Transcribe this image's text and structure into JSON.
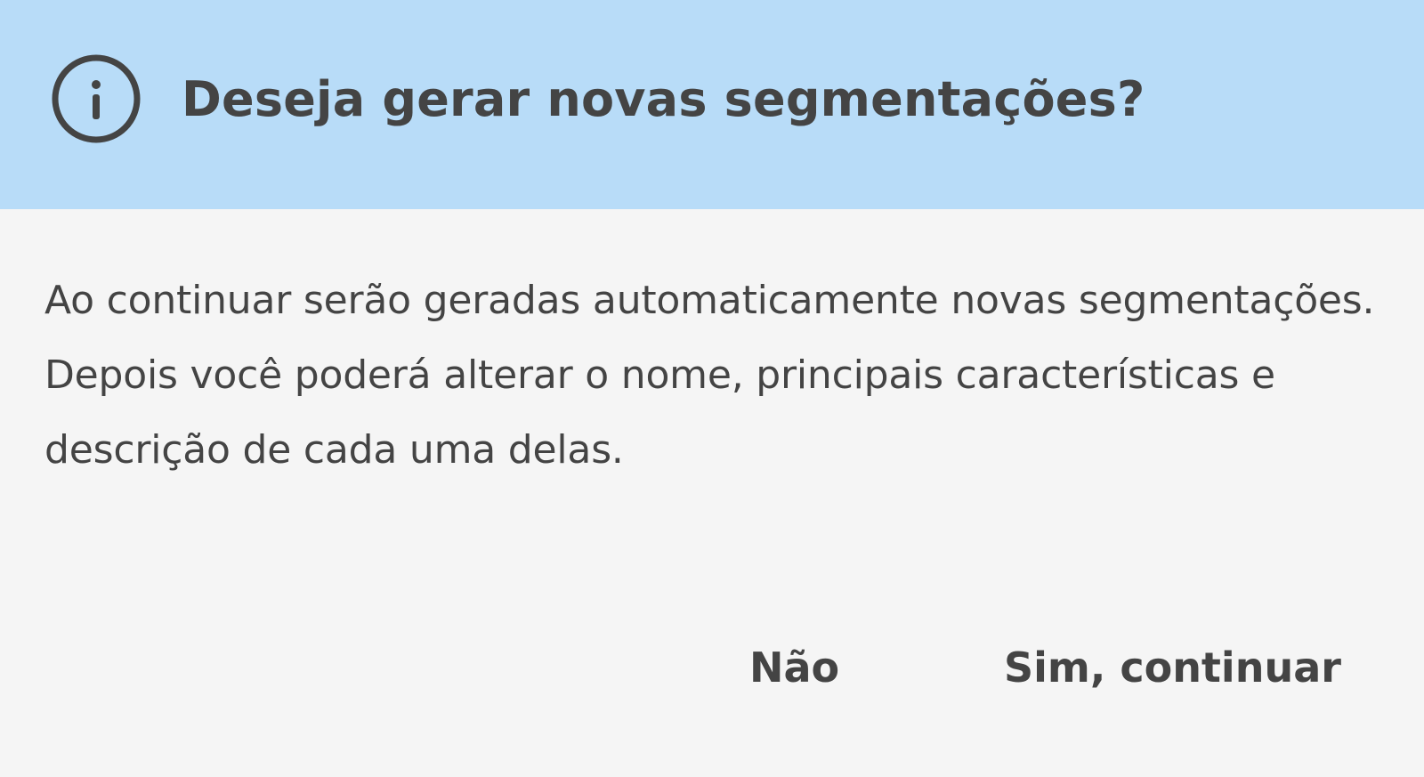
{
  "dialog": {
    "icon": "info-icon",
    "header_color": "#b8dcf8",
    "title": "Deseja gerar novas segmentações?",
    "message": "Ao continuar serão geradas automaticamente novas segmentações. Depois você poderá alterar o nome, principais características e descrição de cada uma delas.",
    "actions": {
      "cancel_label": "Não",
      "confirm_label": "Sim, continuar"
    }
  }
}
